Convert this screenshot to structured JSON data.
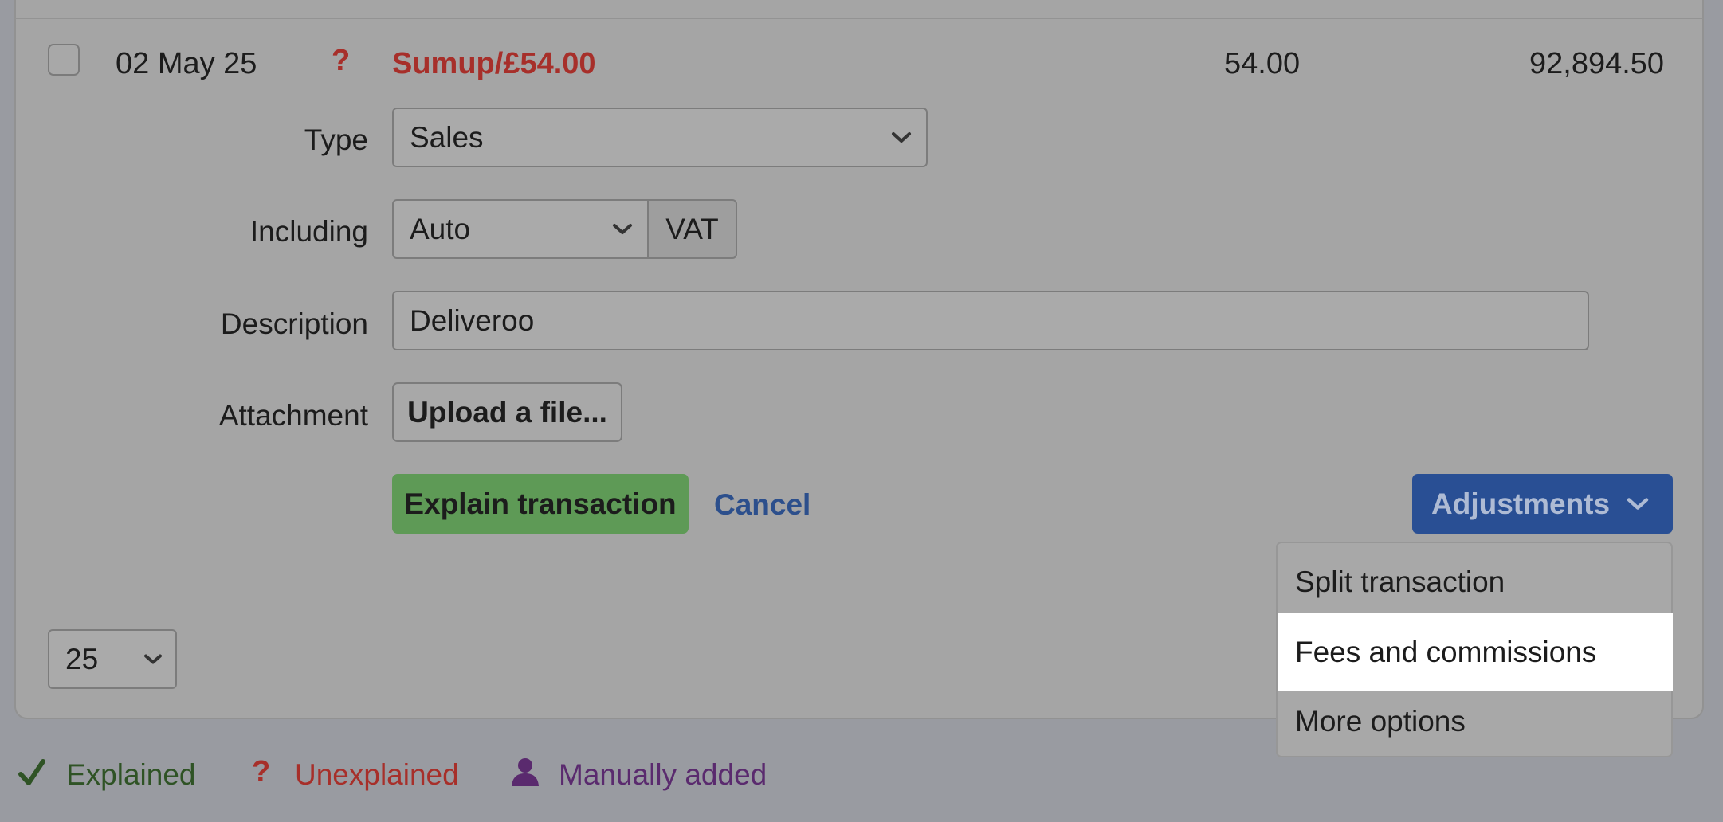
{
  "transaction": {
    "date": "02 May 25",
    "status_icon": "question-mark-icon",
    "name": "Sumup/£54.00",
    "amount": "54.00",
    "balance": "92,894.50"
  },
  "form": {
    "type_label": "Type",
    "type_value": "Sales",
    "including_label": "Including",
    "including_value": "Auto",
    "vat_label": "VAT",
    "description_label": "Description",
    "description_value": "Deliveroo",
    "attachment_label": "Attachment",
    "upload_label": "Upload a file...",
    "explain_label": "Explain transaction",
    "cancel_label": "Cancel",
    "adjustments_label": "Adjustments"
  },
  "adjustments_menu": {
    "items": [
      "Split transaction",
      "Fees and commissions",
      "More options"
    ],
    "highlighted_index": 1
  },
  "pagination": {
    "per_page": "25"
  },
  "legend": {
    "explained": "Explained",
    "unexplained": "Unexplained",
    "manually_added": "Manually added"
  },
  "colors": {
    "unexplained_red": "#a72f2a",
    "explain_green": "#5e9a56",
    "adjustments_blue": "#294f94",
    "cancel_blue": "#2c4f8c",
    "explained_green": "#2f5325",
    "manual_purple": "#5a2a6e"
  }
}
